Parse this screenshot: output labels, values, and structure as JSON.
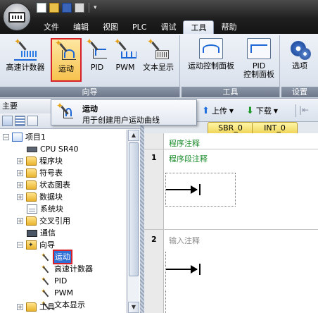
{
  "menu": {
    "items": [
      {
        "label": "文件"
      },
      {
        "label": "编辑"
      },
      {
        "label": "视图"
      },
      {
        "label": "PLC"
      },
      {
        "label": "调试"
      },
      {
        "label": "工具",
        "active": true
      },
      {
        "label": "帮助"
      }
    ]
  },
  "ribbon": {
    "groups": {
      "wizard": {
        "label": "向导"
      },
      "tools": {
        "label": "工具"
      },
      "settings": {
        "label": "设置"
      }
    },
    "buttons": {
      "high_speed_counter": "高速计数器",
      "motion": "运动",
      "pid": "PID",
      "pwm": "PWM",
      "text_display": "文本显示",
      "motion_panel": "运动控制面板",
      "pid_panel_line1": "PID",
      "pid_panel_line2": "控制面板",
      "options": "选项"
    }
  },
  "tooltip": {
    "title": "运动",
    "description": "用于创建用户运动曲线"
  },
  "left_pane": {
    "title": "主要"
  },
  "tree": {
    "project": "项目1",
    "cpu": "CPU SR40",
    "program_block": "程序块",
    "symbol_table": "符号表",
    "status_chart": "状态图表",
    "data_block": "数据块",
    "system_block": "系统块",
    "cross_reference": "交叉引用",
    "communication": "通信",
    "wizards": "向导",
    "wizard_items": {
      "motion": "运动",
      "high_speed_counter": "高速计数器",
      "pid": "PID",
      "pwm": "PWM",
      "text_display": "文本显示"
    },
    "tools": "工具"
  },
  "editor_toolbar": {
    "upload": "上传",
    "download": "下载"
  },
  "tabs": {
    "sbr": "SBR_0",
    "int": "INT_0"
  },
  "editor": {
    "program_comment": "程序注释",
    "networks": [
      {
        "number": "1",
        "comment": "程序段注释"
      },
      {
        "number": "2",
        "comment": "输入注释"
      }
    ]
  }
}
